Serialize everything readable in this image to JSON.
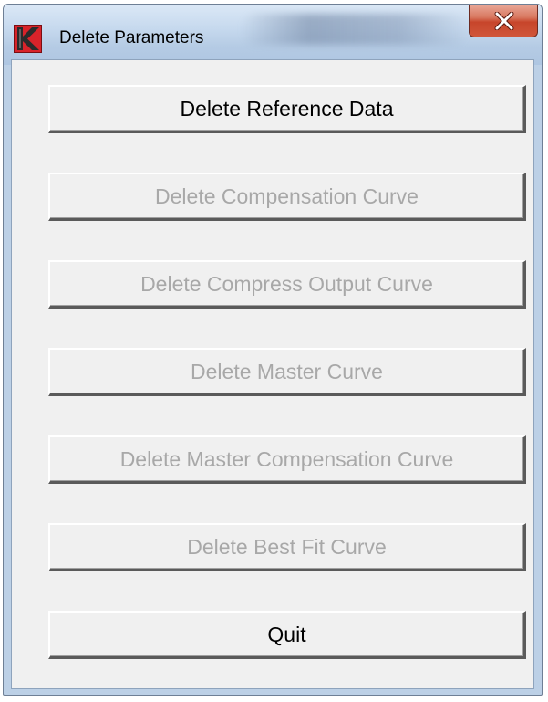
{
  "window": {
    "title": "Delete Parameters",
    "icon": "app-k-logo-icon",
    "close_icon": "close-x-icon"
  },
  "buttons": [
    {
      "label": "Delete Reference Data",
      "enabled": true
    },
    {
      "label": "Delete Compensation Curve",
      "enabled": false
    },
    {
      "label": "Delete Compress Output Curve",
      "enabled": false
    },
    {
      "label": "Delete Master Curve",
      "enabled": false
    },
    {
      "label": "Delete Master Compensation Curve",
      "enabled": false
    },
    {
      "label": "Delete Best Fit Curve",
      "enabled": false
    },
    {
      "label": "Quit",
      "enabled": true
    }
  ],
  "colors": {
    "accent": "#c7452b",
    "disabled_text": "#a8a8a8"
  }
}
